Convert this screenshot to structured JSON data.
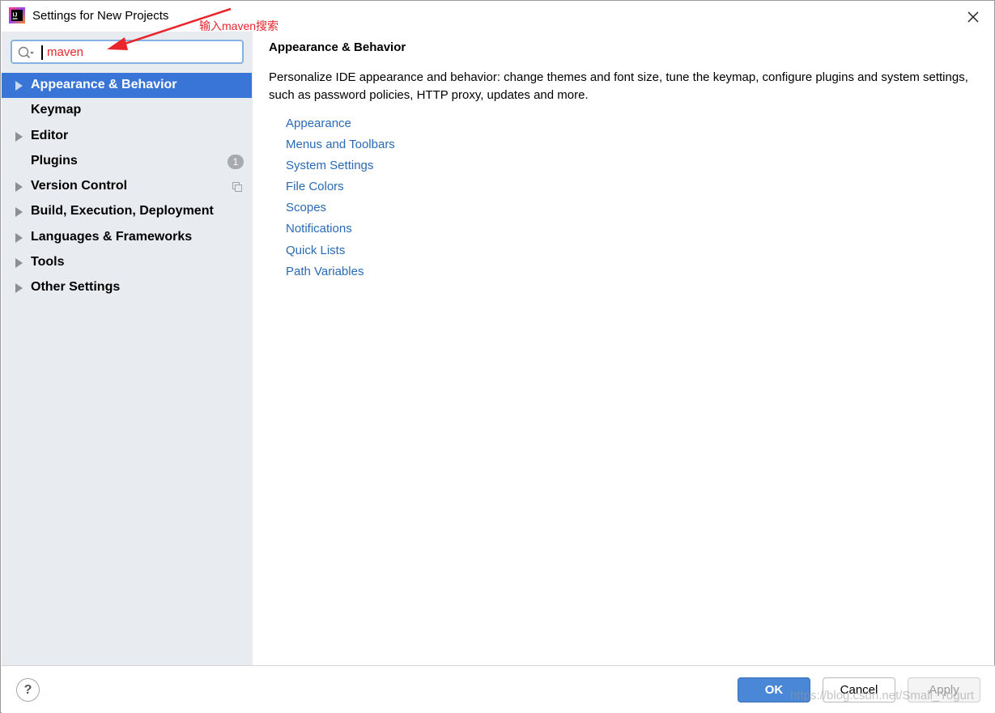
{
  "window": {
    "title": "Settings for New Projects"
  },
  "annotation": {
    "text": "输入maven搜索",
    "color": "#e8262b"
  },
  "search": {
    "value": "maven"
  },
  "sidebar": {
    "items": [
      {
        "label": "Appearance & Behavior",
        "expandable": true,
        "selected": true
      },
      {
        "label": "Keymap",
        "expandable": false
      },
      {
        "label": "Editor",
        "expandable": true
      },
      {
        "label": "Plugins",
        "expandable": false,
        "badge": "1"
      },
      {
        "label": "Version Control",
        "expandable": true,
        "icon": "copy-icon"
      },
      {
        "label": "Build, Execution, Deployment",
        "expandable": true
      },
      {
        "label": "Languages & Frameworks",
        "expandable": true
      },
      {
        "label": "Tools",
        "expandable": true
      },
      {
        "label": "Other Settings",
        "expandable": true
      }
    ]
  },
  "main": {
    "heading": "Appearance & Behavior",
    "description": "Personalize IDE appearance and behavior: change themes and font size, tune the keymap, configure plugins and system settings, such as password policies, HTTP proxy, updates and more.",
    "links": [
      "Appearance",
      "Menus and Toolbars",
      "System Settings",
      "File Colors",
      "Scopes",
      "Notifications",
      "Quick Lists",
      "Path Variables"
    ]
  },
  "footer": {
    "help_label": "?",
    "ok_label": "OK",
    "cancel_label": "Cancel",
    "apply_label": "Apply"
  },
  "watermark": "https://blog.csdn.net/Small_Yogurt",
  "colors": {
    "selection": "#3875d6",
    "link": "#2a6ab4",
    "sidebar_bg": "#e8ecf0",
    "ok_button": "#4a87d6"
  }
}
